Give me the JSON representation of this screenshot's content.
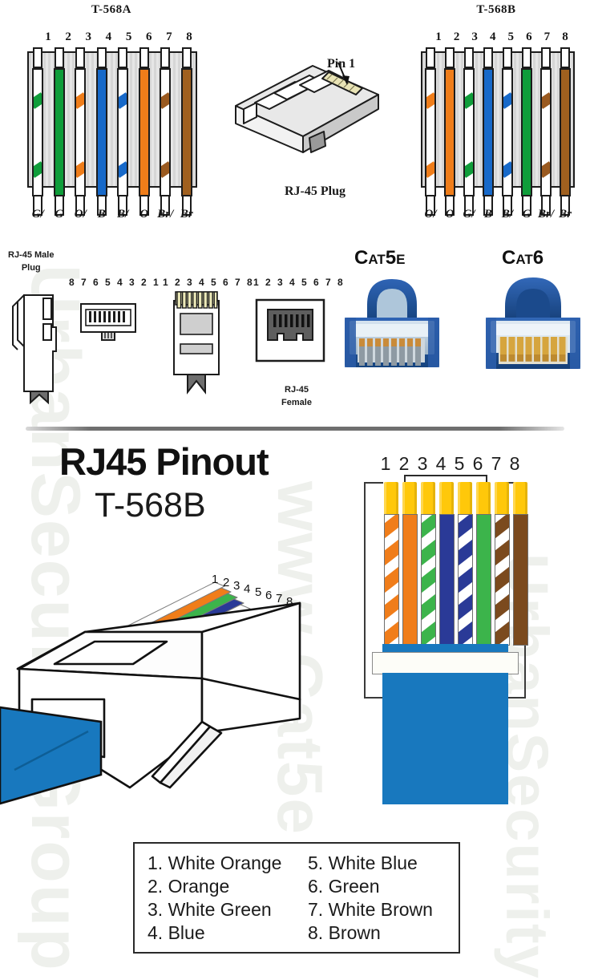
{
  "watermark": {
    "left_text": "UrbanSecurityGroup",
    "center_text": "www.Cat5e",
    "right_text": "UrbanSecurity"
  },
  "top": {
    "standard_a": {
      "title": "T-568A",
      "pins": [
        "1",
        "2",
        "3",
        "4",
        "5",
        "6",
        "7",
        "8"
      ],
      "color_labels": [
        "G/",
        "G",
        "O/",
        "B",
        "B/",
        "O",
        "Br/",
        "Br"
      ],
      "wires": [
        {
          "pin": 1,
          "name": "white-green",
          "base": "#ffffff",
          "stripe": "#0f9d3a",
          "striped": true
        },
        {
          "pin": 2,
          "name": "green",
          "base": "#0f9d3a",
          "stripe": "#0f9d3a",
          "striped": false
        },
        {
          "pin": 3,
          "name": "white-orange",
          "base": "#ffffff",
          "stripe": "#ef7d1a",
          "striped": true
        },
        {
          "pin": 4,
          "name": "blue",
          "base": "#1769c9",
          "stripe": "#1769c9",
          "striped": false
        },
        {
          "pin": 5,
          "name": "white-blue",
          "base": "#ffffff",
          "stripe": "#1769c9",
          "striped": true
        },
        {
          "pin": 6,
          "name": "orange",
          "base": "#ef7d1a",
          "stripe": "#ef7d1a",
          "striped": false
        },
        {
          "pin": 7,
          "name": "white-brown",
          "base": "#ffffff",
          "stripe": "#9a5a20",
          "striped": true
        },
        {
          "pin": 8,
          "name": "brown",
          "base": "#a0601f",
          "stripe": "#a0601f",
          "striped": false
        }
      ]
    },
    "standard_b": {
      "title": "T-568B",
      "pins": [
        "1",
        "2",
        "3",
        "4",
        "5",
        "6",
        "7",
        "8"
      ],
      "color_labels": [
        "O/",
        "O",
        "G/",
        "B",
        "B/",
        "G",
        "Br/",
        "Br"
      ],
      "wires": [
        {
          "pin": 1,
          "name": "white-orange",
          "base": "#ffffff",
          "stripe": "#ef7d1a",
          "striped": true
        },
        {
          "pin": 2,
          "name": "orange",
          "base": "#ef7d1a",
          "stripe": "#ef7d1a",
          "striped": false
        },
        {
          "pin": 3,
          "name": "white-green",
          "base": "#ffffff",
          "stripe": "#0f9d3a",
          "striped": true
        },
        {
          "pin": 4,
          "name": "blue",
          "base": "#1769c9",
          "stripe": "#1769c9",
          "striped": false
        },
        {
          "pin": 5,
          "name": "white-blue",
          "base": "#ffffff",
          "stripe": "#1769c9",
          "striped": true
        },
        {
          "pin": 6,
          "name": "green",
          "base": "#0f9d3a",
          "stripe": "#0f9d3a",
          "striped": false
        },
        {
          "pin": 7,
          "name": "white-brown",
          "base": "#ffffff",
          "stripe": "#9a5a20",
          "striped": true
        },
        {
          "pin": 8,
          "name": "brown",
          "base": "#a0601f",
          "stripe": "#a0601f",
          "striped": false
        }
      ]
    },
    "plug": {
      "pin1_label": "Pin 1",
      "caption": "RJ-45 Plug"
    }
  },
  "middle": {
    "male_plug_label_line1": "RJ-45 Male",
    "male_plug_label_line2": "Plug",
    "jack_numbers_reverse": "8 7 6 5 4 3 2 1",
    "plug_numbers_1": "1 2 3 4 5 6 7 8",
    "plug_numbers_2": "1 2 3 4 5 6 7 8",
    "female_label_line1": "RJ-45",
    "female_label_line2": "Female",
    "cat5e": {
      "prefix": "C",
      "rest": "AT",
      "num": "5",
      "suffix": "E",
      "full": "Cat5e"
    },
    "cat6": {
      "prefix": "C",
      "rest": "AT",
      "num": "6",
      "suffix": "",
      "full": "Cat6"
    }
  },
  "bottom": {
    "title": "RJ45 Pinout",
    "subtitle": "T-568B",
    "pins": [
      "1",
      "2",
      "3",
      "4",
      "5",
      "6",
      "7",
      "8"
    ],
    "bracket_span": "2-7",
    "cable_jacket_color": "#1878BE",
    "pin_tip_color": "#FFC80A",
    "iso_pin_numbers": [
      "1",
      "2",
      "3",
      "4",
      "5",
      "6",
      "7",
      "8"
    ],
    "wires": [
      {
        "pin": 1,
        "name": "white-orange",
        "base": "#ffffff",
        "stripe": "#F07D1A",
        "striped": true
      },
      {
        "pin": 2,
        "name": "orange",
        "base": "#F07D1A",
        "stripe": "#F07D1A",
        "striped": false
      },
      {
        "pin": 3,
        "name": "white-green",
        "base": "#ffffff",
        "stripe": "#3CB44B",
        "striped": true
      },
      {
        "pin": 4,
        "name": "blue",
        "base": "#2A3A97",
        "stripe": "#2A3A97",
        "striped": false
      },
      {
        "pin": 5,
        "name": "white-blue",
        "base": "#ffffff",
        "stripe": "#2A3A97",
        "striped": true
      },
      {
        "pin": 6,
        "name": "green",
        "base": "#3CB44B",
        "stripe": "#3CB44B",
        "striped": false
      },
      {
        "pin": 7,
        "name": "white-brown",
        "base": "#ffffff",
        "stripe": "#7B4A1E",
        "striped": true
      },
      {
        "pin": 8,
        "name": "brown",
        "base": "#7B4A1E",
        "stripe": "#7B4A1E",
        "striped": false
      }
    ],
    "legend": {
      "left": [
        "1. White Orange",
        "2. Orange",
        "3. White Green",
        "4. Blue"
      ],
      "right": [
        "5. White Blue",
        "6. Green",
        "7. White Brown",
        "8. Brown"
      ]
    }
  }
}
